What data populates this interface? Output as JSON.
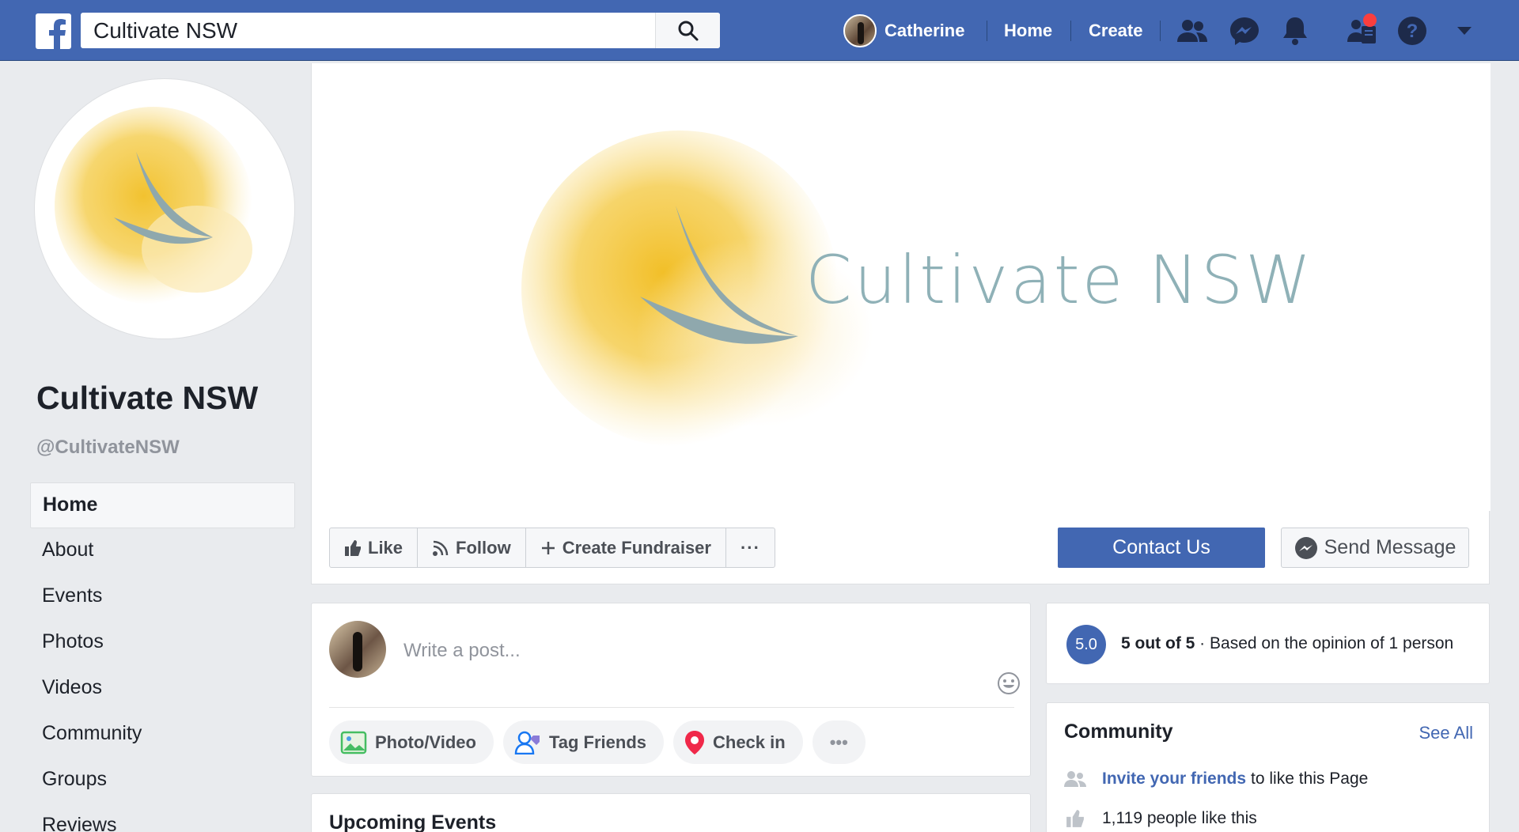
{
  "topbar": {
    "search_value": "Cultivate NSW",
    "user_name": "Catherine",
    "home_label": "Home",
    "create_label": "Create",
    "icons": [
      "facebook-logo-icon",
      "search-icon",
      "friends-icon",
      "messenger-icon",
      "notifications-icon",
      "friend-requests-icon",
      "help-icon",
      "caret-down-icon"
    ],
    "brand_color": "#4267b2"
  },
  "page": {
    "name": "Cultivate NSW",
    "handle": "@CultivateNSW",
    "cover_title": "Cultivate NSW"
  },
  "sidebar": {
    "items": [
      {
        "label": "Home",
        "active": true
      },
      {
        "label": "About"
      },
      {
        "label": "Events"
      },
      {
        "label": "Photos"
      },
      {
        "label": "Videos"
      },
      {
        "label": "Community"
      },
      {
        "label": "Groups"
      },
      {
        "label": "Reviews"
      }
    ]
  },
  "actions": {
    "like": "Like",
    "follow": "Follow",
    "fundraiser": "Create Fundraiser",
    "more": "···",
    "contact": "Contact Us",
    "send_message": "Send Message"
  },
  "composer": {
    "placeholder": "Write a post...",
    "photo_video": "Photo/Video",
    "tag_friends": "Tag Friends",
    "check_in": "Check in",
    "more": "•••"
  },
  "events": {
    "title": "Upcoming Events"
  },
  "rating": {
    "score": "5.0",
    "summary": "5 out of 5",
    "detail": " · Based on the opinion of 1 person"
  },
  "community": {
    "title": "Community",
    "see_all": "See All",
    "invite_link": "Invite your friends",
    "invite_rest": "to like this Page",
    "likes": "1,119 people like this"
  }
}
